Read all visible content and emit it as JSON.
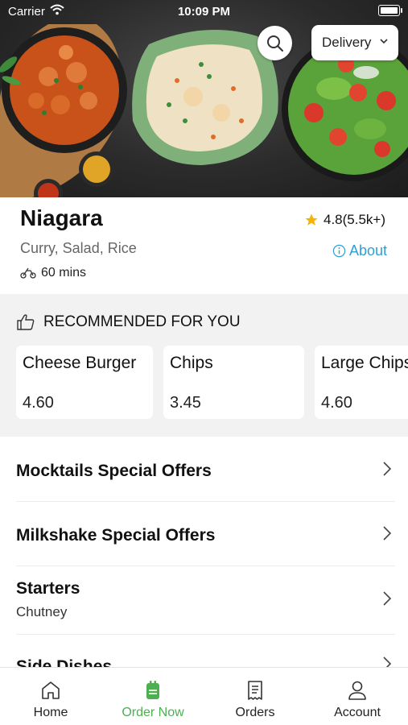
{
  "status_bar": {
    "carrier": "Carrier",
    "time": "10:09 PM"
  },
  "header": {
    "order_mode": "Delivery"
  },
  "restaurant": {
    "name": "Niagara",
    "cuisines": "Curry, Salad, Rice",
    "delivery_time": "60 mins",
    "rating": "4.8(5.5k+)",
    "about_label": "About"
  },
  "recommended": {
    "heading": "RECOMMENDED FOR YOU",
    "items": [
      {
        "name": "Cheese Burger",
        "price": "4.60"
      },
      {
        "name": "Chips",
        "price": "3.45"
      },
      {
        "name": "Large Chips",
        "price": "4.60"
      }
    ]
  },
  "categories": [
    {
      "title": "Mocktails Special Offers",
      "subtitle": ""
    },
    {
      "title": "Milkshake Special Offers",
      "subtitle": ""
    },
    {
      "title": "Starters",
      "subtitle": "Chutney"
    },
    {
      "title": "Side Dishes",
      "subtitle": ""
    }
  ],
  "tabs": [
    {
      "label": "Home",
      "icon": "home-icon",
      "active": false
    },
    {
      "label": "Order Now",
      "icon": "order-bag-icon",
      "active": true
    },
    {
      "label": "Orders",
      "icon": "receipt-icon",
      "active": false
    },
    {
      "label": "Account",
      "icon": "person-icon",
      "active": false
    }
  ],
  "colors": {
    "accent_green": "#4caf50",
    "link_blue": "#2f9fd3",
    "star": "#f5b301"
  }
}
